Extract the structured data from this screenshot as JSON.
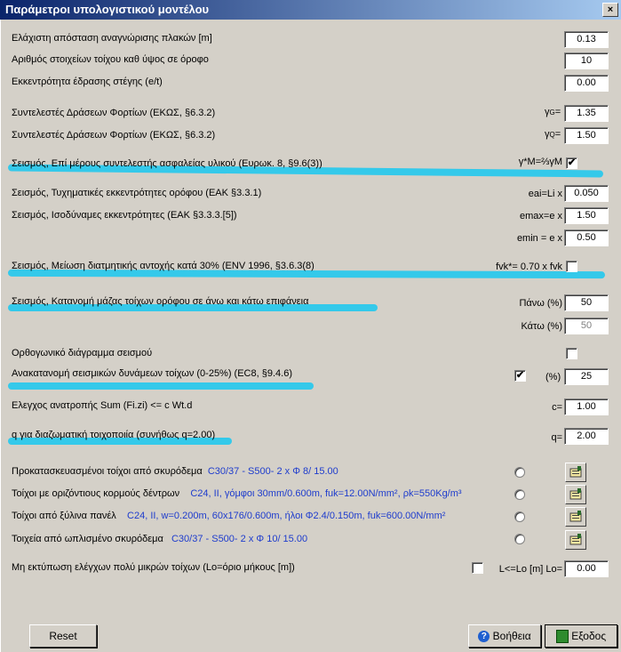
{
  "window": {
    "title": "Παράμετροι υπολογιστικού μοντέλου",
    "close_label": "×"
  },
  "rows": {
    "r1": {
      "label": "Ελάχιστη απόσταση αναγνώρισης πλακών [m]",
      "value": "0.13"
    },
    "r2": {
      "label": "Αριθμός  στοιχείων τοίχου καθ ύψος σε όροφο",
      "value": "10"
    },
    "r3": {
      "label": "Εκκεντρότητα έδρασης στέγης (e/t)",
      "value": "0.00"
    },
    "r4": {
      "label": "Συντελεστές Δράσεων Φορτίων (ΕΚΩΣ, §6.3.2)",
      "sym": "γ",
      "sub": "G",
      "eq": "=",
      "value": "1.35"
    },
    "r5": {
      "label": "Συντελεστές Δράσεων Φορτίων (ΕΚΩΣ, §6.3.2)",
      "sym": "γ",
      "sub": "Q",
      "eq": "=",
      "value": "1.50"
    },
    "r6": {
      "label": "Σεισμός, Επί μέρους συντελεστής ασφαλείας υλικού (Ευρωκ. 8, §9.6(3))",
      "formula": "γ*M=⅔γM",
      "checked": "✔"
    },
    "r7": {
      "label": "Σεισμός, Τυχηματικές εκκεντρότητες ορόφου (ΕΑΚ §3.3.1)",
      "formula": "eai=Li  x",
      "value": "0.050"
    },
    "r8": {
      "label": "Σεισμός, Ισοδύναμες εκκεντρότητες (ΕΑΚ §3.3.3.[5])",
      "formula": "emax=e  x",
      "value": "1.50"
    },
    "r9": {
      "formula": "emin = e  x",
      "value": "0.50"
    },
    "r10": {
      "label": "Σεισμός, Μείωση διατμητικής αντοχής κατά 30% (ENV 1996, §3.6.3(8)",
      "formula": "fvk*= 0.70 x fvk"
    },
    "r11": {
      "label": "Σεισμός, Κατανομή μάζας τοίχων ορόφου σε άνω και κάτω επιφάνεια",
      "formula": "Πάνω (%)",
      "value": "50"
    },
    "r12": {
      "formula": "Κάτω (%)",
      "value": "50"
    },
    "r13": {
      "label": "Ορθογωνικό διάγραμμα σεισμού"
    },
    "r14": {
      "label": "Ανακατανομή σεισμικών δυνάμεων τοίχων (0-25%) (EC8, §9.4.6)",
      "checked": "✔",
      "unit": "(%)",
      "value": "25"
    },
    "r15": {
      "label": "Ελεγχος ανατροπής   Sum (Fi.zi) <= c Wt.d",
      "formula": "c=",
      "value": "1.00"
    },
    "r16": {
      "label": "q για διαζωματική τοιχοποιία (συνήθως q=2.00)",
      "formula": "q=",
      "value": "2.00"
    },
    "m1": {
      "label": "Προκατασκευασμένοι τοίχοι από σκυρόδεμα",
      "spec": "C30/37 - S500- 2 x Φ  8/  15.00"
    },
    "m2": {
      "label": "Τοίχοι με οριζόντιους κορμούς δέντρων",
      "spec": "C24,  II, γόμφοι 30mm/0.600m, fuk=12.00N/mm², ρk=550Kg/m³"
    },
    "m3": {
      "label": "Τοίχοι από ξύλινα πανέλ",
      "spec": "C24,  II, w=0.200m, 60x176/0.600m, ήλοι Φ2.4/0.150m, fuk=600.00N/mm²"
    },
    "m4": {
      "label": "Τοιχεία από ωπλισμένο σκυρόδεμα",
      "spec": "C30/37 - S500- 2 x Φ  10/  15.00"
    },
    "r17": {
      "label": "Μη εκτύπωση ελέγχων πολύ μικρών τοίχων (Lo=όριο μήκους [m])",
      "formula": "L<=Lo [m] Lo=",
      "value": "0.00"
    }
  },
  "buttons": {
    "reset": "Reset",
    "help": "Βοήθεια",
    "exit": "Εξοδος"
  },
  "colors": {
    "highlight": "#17c8f0",
    "spec_text": "#1e3ccd",
    "title_bar": "#0a246a"
  }
}
